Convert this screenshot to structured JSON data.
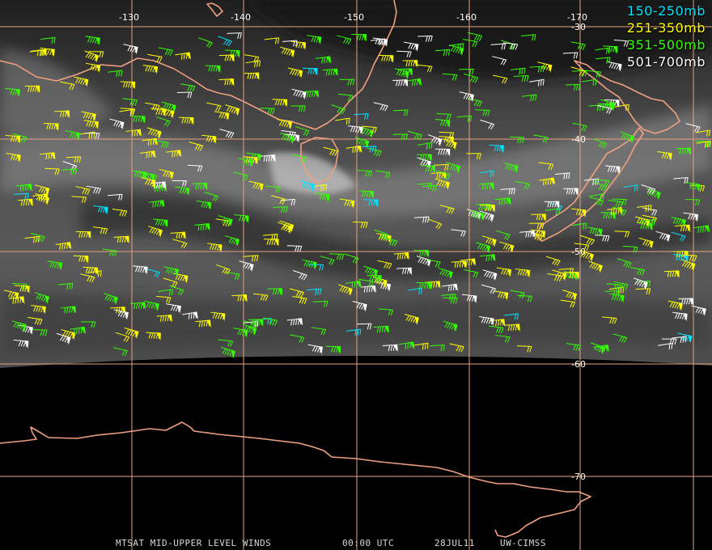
{
  "map": {
    "longitude_labels": [
      "-130",
      "-140",
      "-150",
      "-160",
      "-170"
    ],
    "latitude_labels": [
      "-30",
      "-40",
      "-50",
      "-60",
      "-70"
    ],
    "gridline_color": "#e8a080",
    "coastline_color": "#f0a080"
  },
  "legend": {
    "items": [
      {
        "label": "150-250mb",
        "color": "#00e5ff"
      },
      {
        "label": "251-350mb",
        "color": "#ffff00"
      },
      {
        "label": "351-500mb",
        "color": "#33ff00"
      },
      {
        "label": "501-700mb",
        "color": "#ffffff"
      }
    ]
  },
  "footer": {
    "product": "MTSAT MID-UPPER LEVEL WINDS",
    "time": "00:00 UTC",
    "date": "28JUL11",
    "source": "UW-CIMSS"
  }
}
